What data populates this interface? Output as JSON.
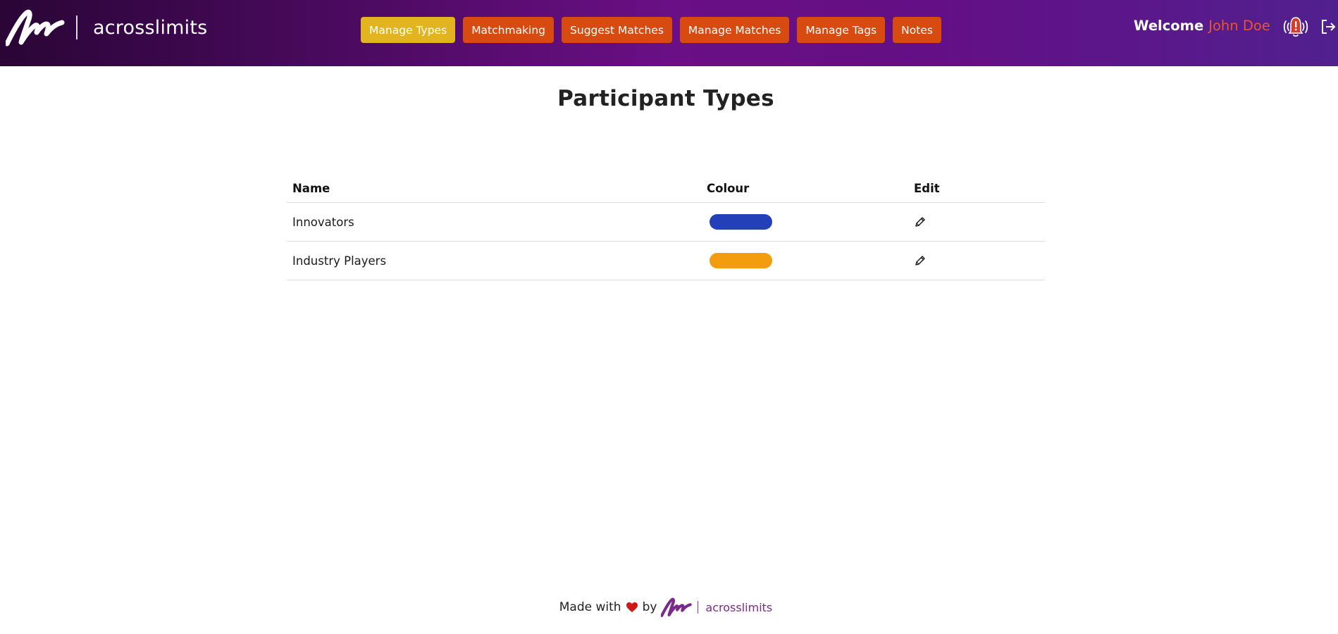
{
  "header": {
    "brand": "acrosslimits",
    "nav": [
      {
        "label": "Manage Types",
        "active": true
      },
      {
        "label": "Matchmaking",
        "active": false
      },
      {
        "label": "Suggest Matches",
        "active": false
      },
      {
        "label": "Manage Matches",
        "active": false
      },
      {
        "label": "Manage Tags",
        "active": false
      },
      {
        "label": "Notes",
        "active": false
      }
    ],
    "welcome_label": "Welcome",
    "user_name": "John Doe",
    "icons": {
      "notifications": "bell-alert-icon",
      "logout": "logout-icon"
    }
  },
  "page": {
    "title": "Participant Types"
  },
  "table": {
    "columns": [
      "Name",
      "Colour",
      "Edit"
    ],
    "rows": [
      {
        "name": "Innovators",
        "colour": "#2340b8"
      },
      {
        "name": "Industry Players",
        "colour": "#f39c0e"
      }
    ]
  },
  "footer": {
    "made_with": "Made with",
    "by": "by",
    "brand": "acrosslimits"
  },
  "colors": {
    "nav_button": "#d74a10",
    "nav_active": "#e2b520",
    "user_name": "#e9562a",
    "footer_brand": "#7a2a8a"
  }
}
